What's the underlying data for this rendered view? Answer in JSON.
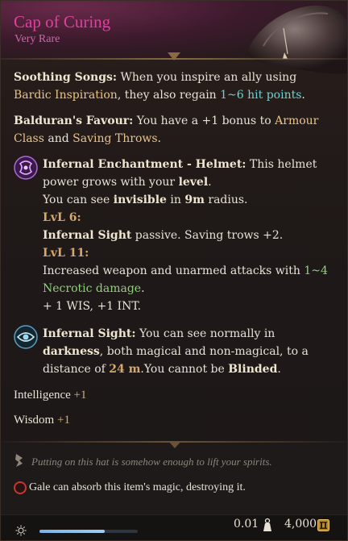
{
  "item": {
    "name": "Cap of Curing",
    "rarity": "Very Rare"
  },
  "colors": {
    "title": "#e13fa0",
    "rarity": "#c76aa8",
    "keyword": "#e9c38a",
    "dice": "#6fd1d0",
    "necrotic": "#8fd17a",
    "stat_value": "#d7a86a"
  },
  "soothing": {
    "name": "Soothing Songs:",
    "text1": " When you inspire an ally using ",
    "kw": "Bardic Inspiration",
    "text2": ", they also regain ",
    "dice": "1~6 hit points",
    "text3": "."
  },
  "favour": {
    "name": "Balduran's Favour:",
    "text1": " You have a +1 bonus to ",
    "kw1": "Armour Class",
    "text2": " and ",
    "kw2": "Saving Throws",
    "text3": "."
  },
  "enchant": {
    "icon": "infernal-rune-icon",
    "name": "Infernal Enchantment - Helmet:",
    "text1": " This helmet power grows with your ",
    "kw1": "level",
    "text2": ".",
    "line2a": "You can see ",
    "line2kw1": "invisible",
    "line2b": " in ",
    "line2kw2": "9m",
    "line2c": " radius.",
    "lvl6": "LvL 6:",
    "lvl6_kw": "Infernal Sight",
    "lvl6_text": " passive. Saving trows +2.",
    "lvl11": "LvL 11:",
    "lvl11_text": "Increased weapon and unarmed attacks with ",
    "lvl11_dice": "1~4",
    "lvl11_dmg": "Necrotic damage",
    "lvl11_end": ".",
    "bonus": "+ 1 WIS, +1 INT."
  },
  "sight": {
    "icon": "eye-vision-icon",
    "name": "Infernal Sight:",
    "text1": " You can see normally in ",
    "kw1": "darkness",
    "text2": ", both magical and non-magical, to a distance of ",
    "kw2": "24 m",
    "text3": ".You cannot be ",
    "kw3": "Blinded",
    "text4": "."
  },
  "stats": [
    {
      "name": "Intelligence",
      "value": "+1"
    },
    {
      "name": "Wisdom",
      "value": "+1"
    }
  ],
  "footer": {
    "flavor_icon": "quill-icon",
    "flavor": "Putting on this hat is somehow enough to lift your spirits.",
    "absorb_icon": "warning-absorb-icon",
    "absorb": "Gale can absorb this item's magic, destroying it.",
    "weight": "0.01",
    "weight_icon": "weight-icon",
    "price": "4,000",
    "coin_icon": "gold-coin-icon",
    "light_icon": "sun-icon",
    "slider_fraction": 0.66
  }
}
